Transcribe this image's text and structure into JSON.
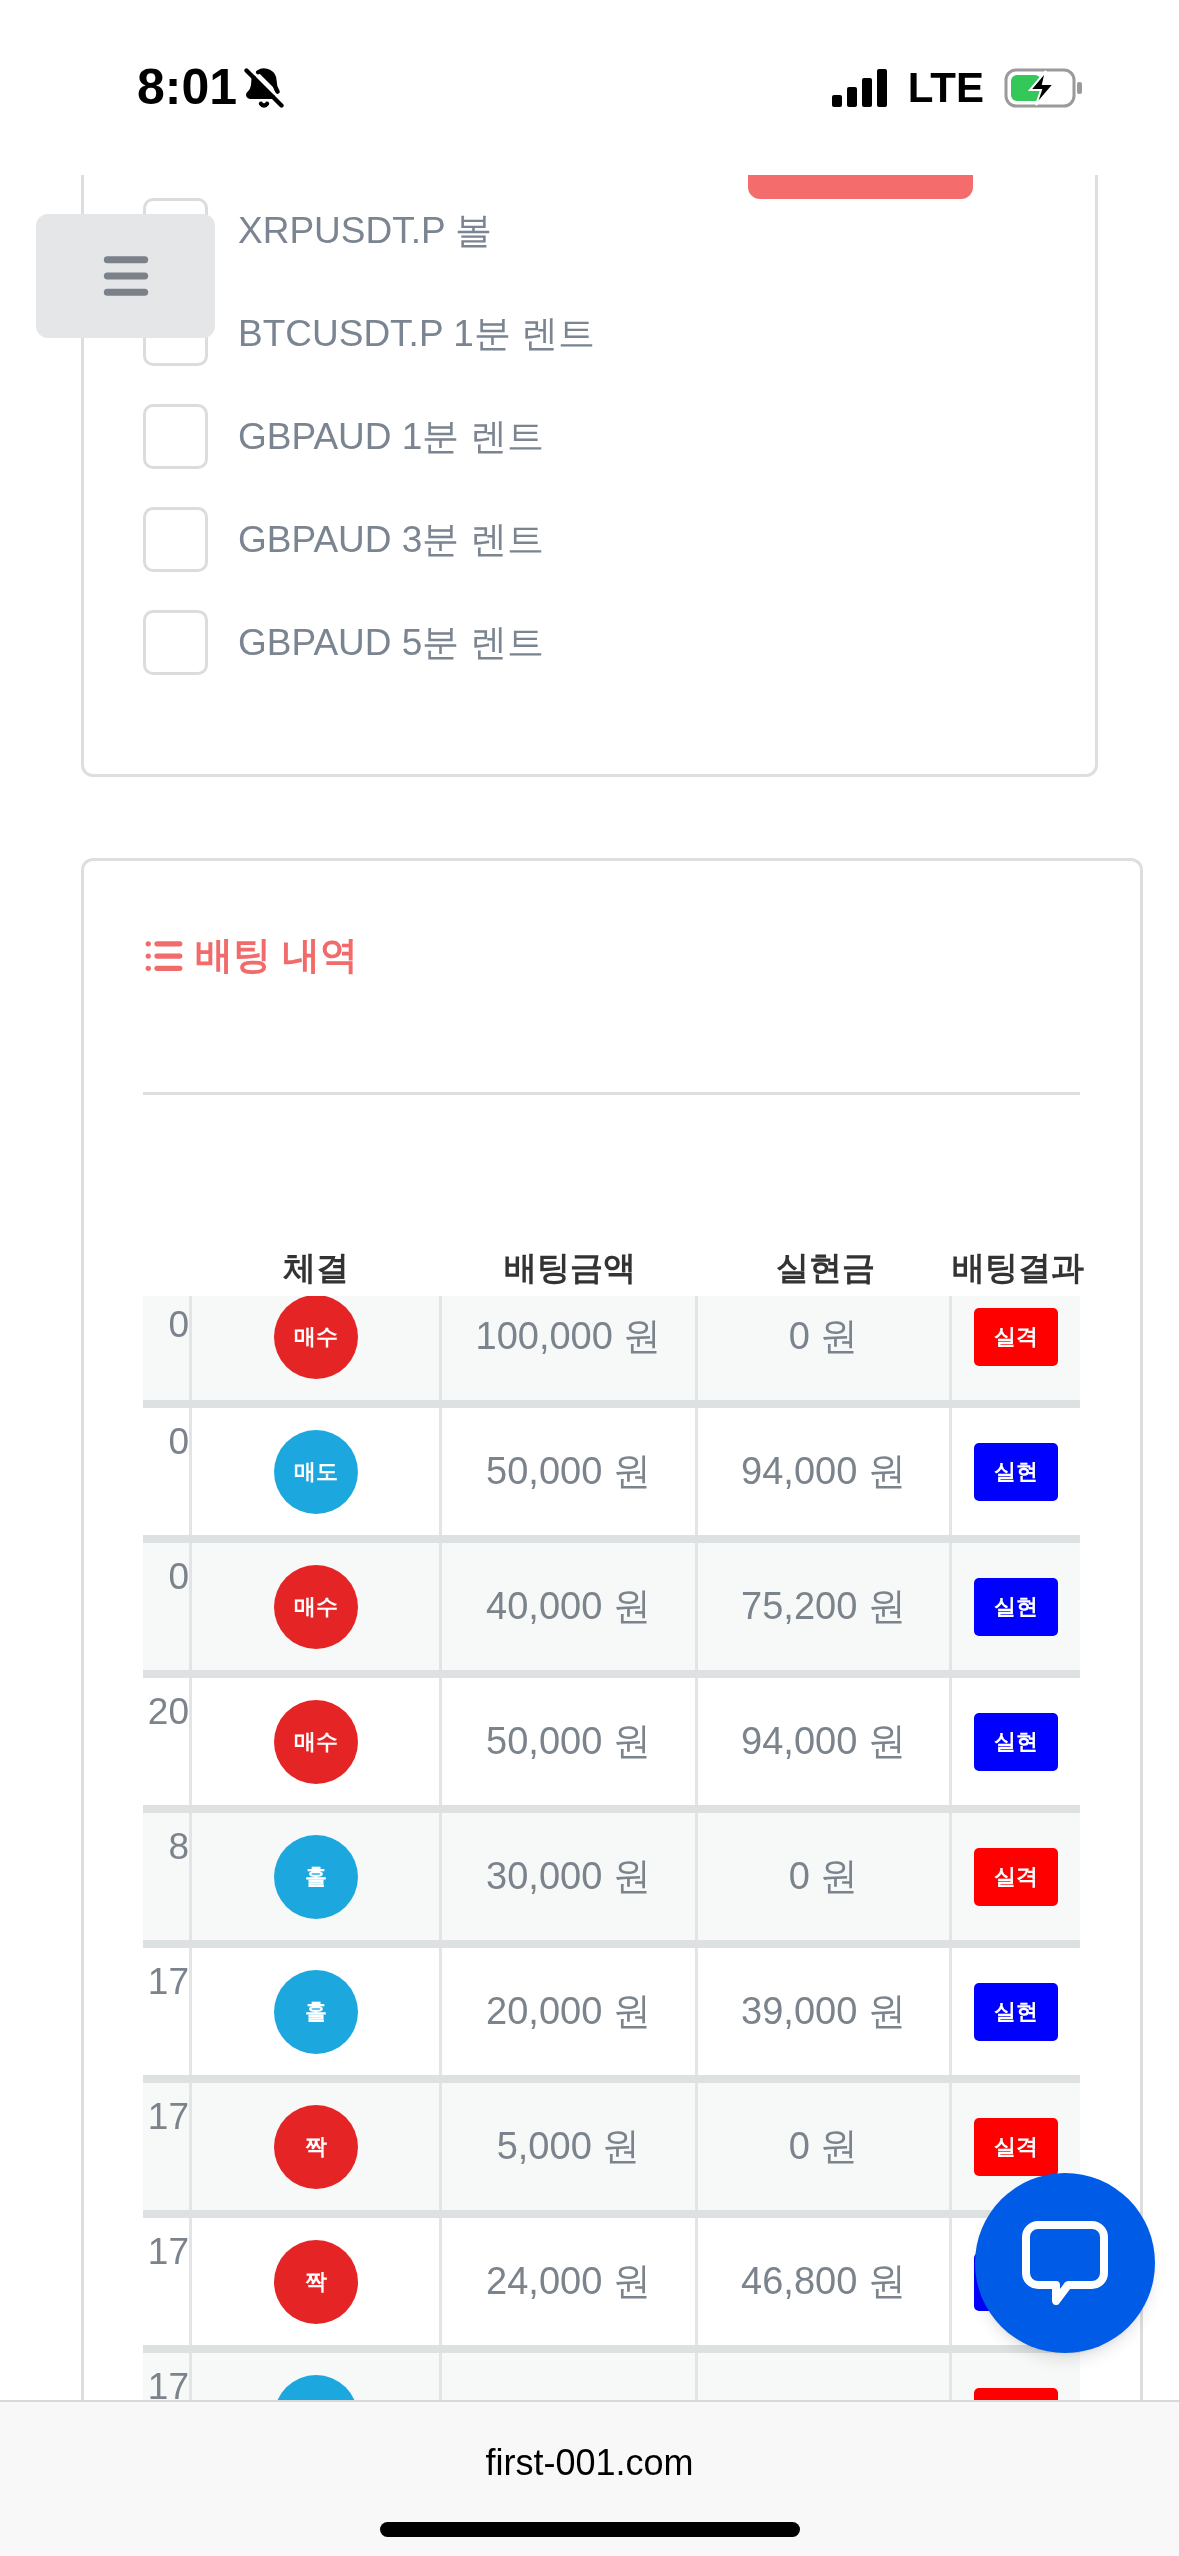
{
  "status_bar": {
    "time": "8:01",
    "network": "LTE"
  },
  "filter_list": {
    "items": [
      {
        "label": "XRPUSDT.P 볼",
        "checked": false
      },
      {
        "label": "BTCUSDT.P 1분 렌트",
        "checked": false
      },
      {
        "label": "GBPAUD 1분 렌트",
        "checked": false
      },
      {
        "label": "GBPAUD 3분 렌트",
        "checked": false
      },
      {
        "label": "GBPAUD 5분 렌트",
        "checked": false
      }
    ]
  },
  "history": {
    "title": "배팅 내역",
    "table": {
      "columns": [
        "체결",
        "배팅금액",
        "실현금",
        "배팅결과"
      ],
      "rows": [
        {
          "column_1": "0",
          "side": {
            "label": "매수",
            "color": "#e52525"
          },
          "amount": "100,000 원",
          "realized": "0 원",
          "result": {
            "label": "실격",
            "color": "#ff0000"
          }
        },
        {
          "column_1": "0",
          "side": {
            "label": "매도",
            "color": "#1ca8de"
          },
          "amount": "50,000 원",
          "realized": "94,000 원",
          "result": {
            "label": "실현",
            "color": "#0000ff"
          }
        },
        {
          "column_1": "0",
          "side": {
            "label": "매수",
            "color": "#e52525"
          },
          "amount": "40,000 원",
          "realized": "75,200 원",
          "result": {
            "label": "실현",
            "color": "#0000ff"
          }
        },
        {
          "column_1": "20",
          "side": {
            "label": "매수",
            "color": "#e52525"
          },
          "amount": "50,000 원",
          "realized": "94,000 원",
          "result": {
            "label": "실현",
            "color": "#0000ff"
          }
        },
        {
          "column_1": "8",
          "side": {
            "label": "홀",
            "color": "#1ca8de"
          },
          "amount": "30,000 원",
          "realized": "0 원",
          "result": {
            "label": "실격",
            "color": "#ff0000"
          }
        },
        {
          "column_1": "17",
          "side": {
            "label": "홀",
            "color": "#1ca8de"
          },
          "amount": "20,000 원",
          "realized": "39,000 원",
          "result": {
            "label": "실현",
            "color": "#0000ff"
          }
        },
        {
          "column_1": "17",
          "side": {
            "label": "짝",
            "color": "#e52525"
          },
          "amount": "5,000 원",
          "realized": "0 원",
          "result": {
            "label": "실격",
            "color": "#ff0000"
          }
        },
        {
          "column_1": "17",
          "side": {
            "label": "짝",
            "color": "#e52525"
          },
          "amount": "24,000 원",
          "realized": "46,800 원",
          "result": {
            "color": "#0000ff"
          }
        },
        {
          "column_1": "17",
          "side": {
            "color": "#1ca8de"
          },
          "result": {
            "color": "#ff0000"
          }
        }
      ]
    }
  },
  "browser_bar": {
    "url": "first-001.com"
  }
}
